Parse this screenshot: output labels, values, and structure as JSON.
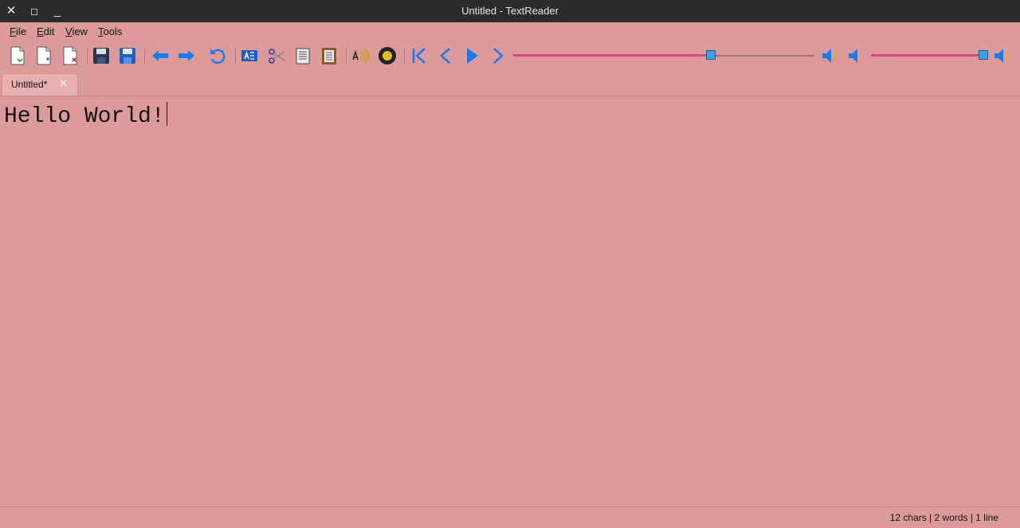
{
  "window": {
    "title": "Untitled - TextReader",
    "close_glyph": "✕",
    "maximize_glyph": "◻",
    "minimize_glyph": "_"
  },
  "menus": [
    {
      "label": "File",
      "mnemonic": "F",
      "rest": "ile"
    },
    {
      "label": "Edit",
      "mnemonic": "E",
      "rest": "dit"
    },
    {
      "label": "View",
      "mnemonic": "V",
      "rest": "iew"
    },
    {
      "label": "Tools",
      "mnemonic": "T",
      "rest": "ools"
    }
  ],
  "toolbar_icons": [
    "open-file-icon",
    "new-file-icon",
    "close-file-icon",
    "save-icon",
    "save-as-icon",
    "undo-arrow-icon",
    "redo-arrow-icon",
    "reload-icon",
    "select-all-icon",
    "cut-scissors-icon",
    "copy-icon",
    "paste-icon",
    "speak-icon",
    "record-icon",
    "skip-to-start-icon",
    "previous-icon",
    "play-icon",
    "next-icon",
    "volume-down-speaker-icon",
    "volume-up-speaker-icon"
  ],
  "sliders": {
    "position": 0.66,
    "volume": 1.0
  },
  "colors": {
    "accent_blue": "#1d7be6",
    "background": "#dd9a9a",
    "slider_fill": "#d8467a"
  },
  "tab": {
    "label": "Untitled*",
    "close_glyph": "✕"
  },
  "editor": {
    "content": "Hello World!"
  },
  "status": {
    "text": "12 chars | 2 words | 1 line"
  }
}
